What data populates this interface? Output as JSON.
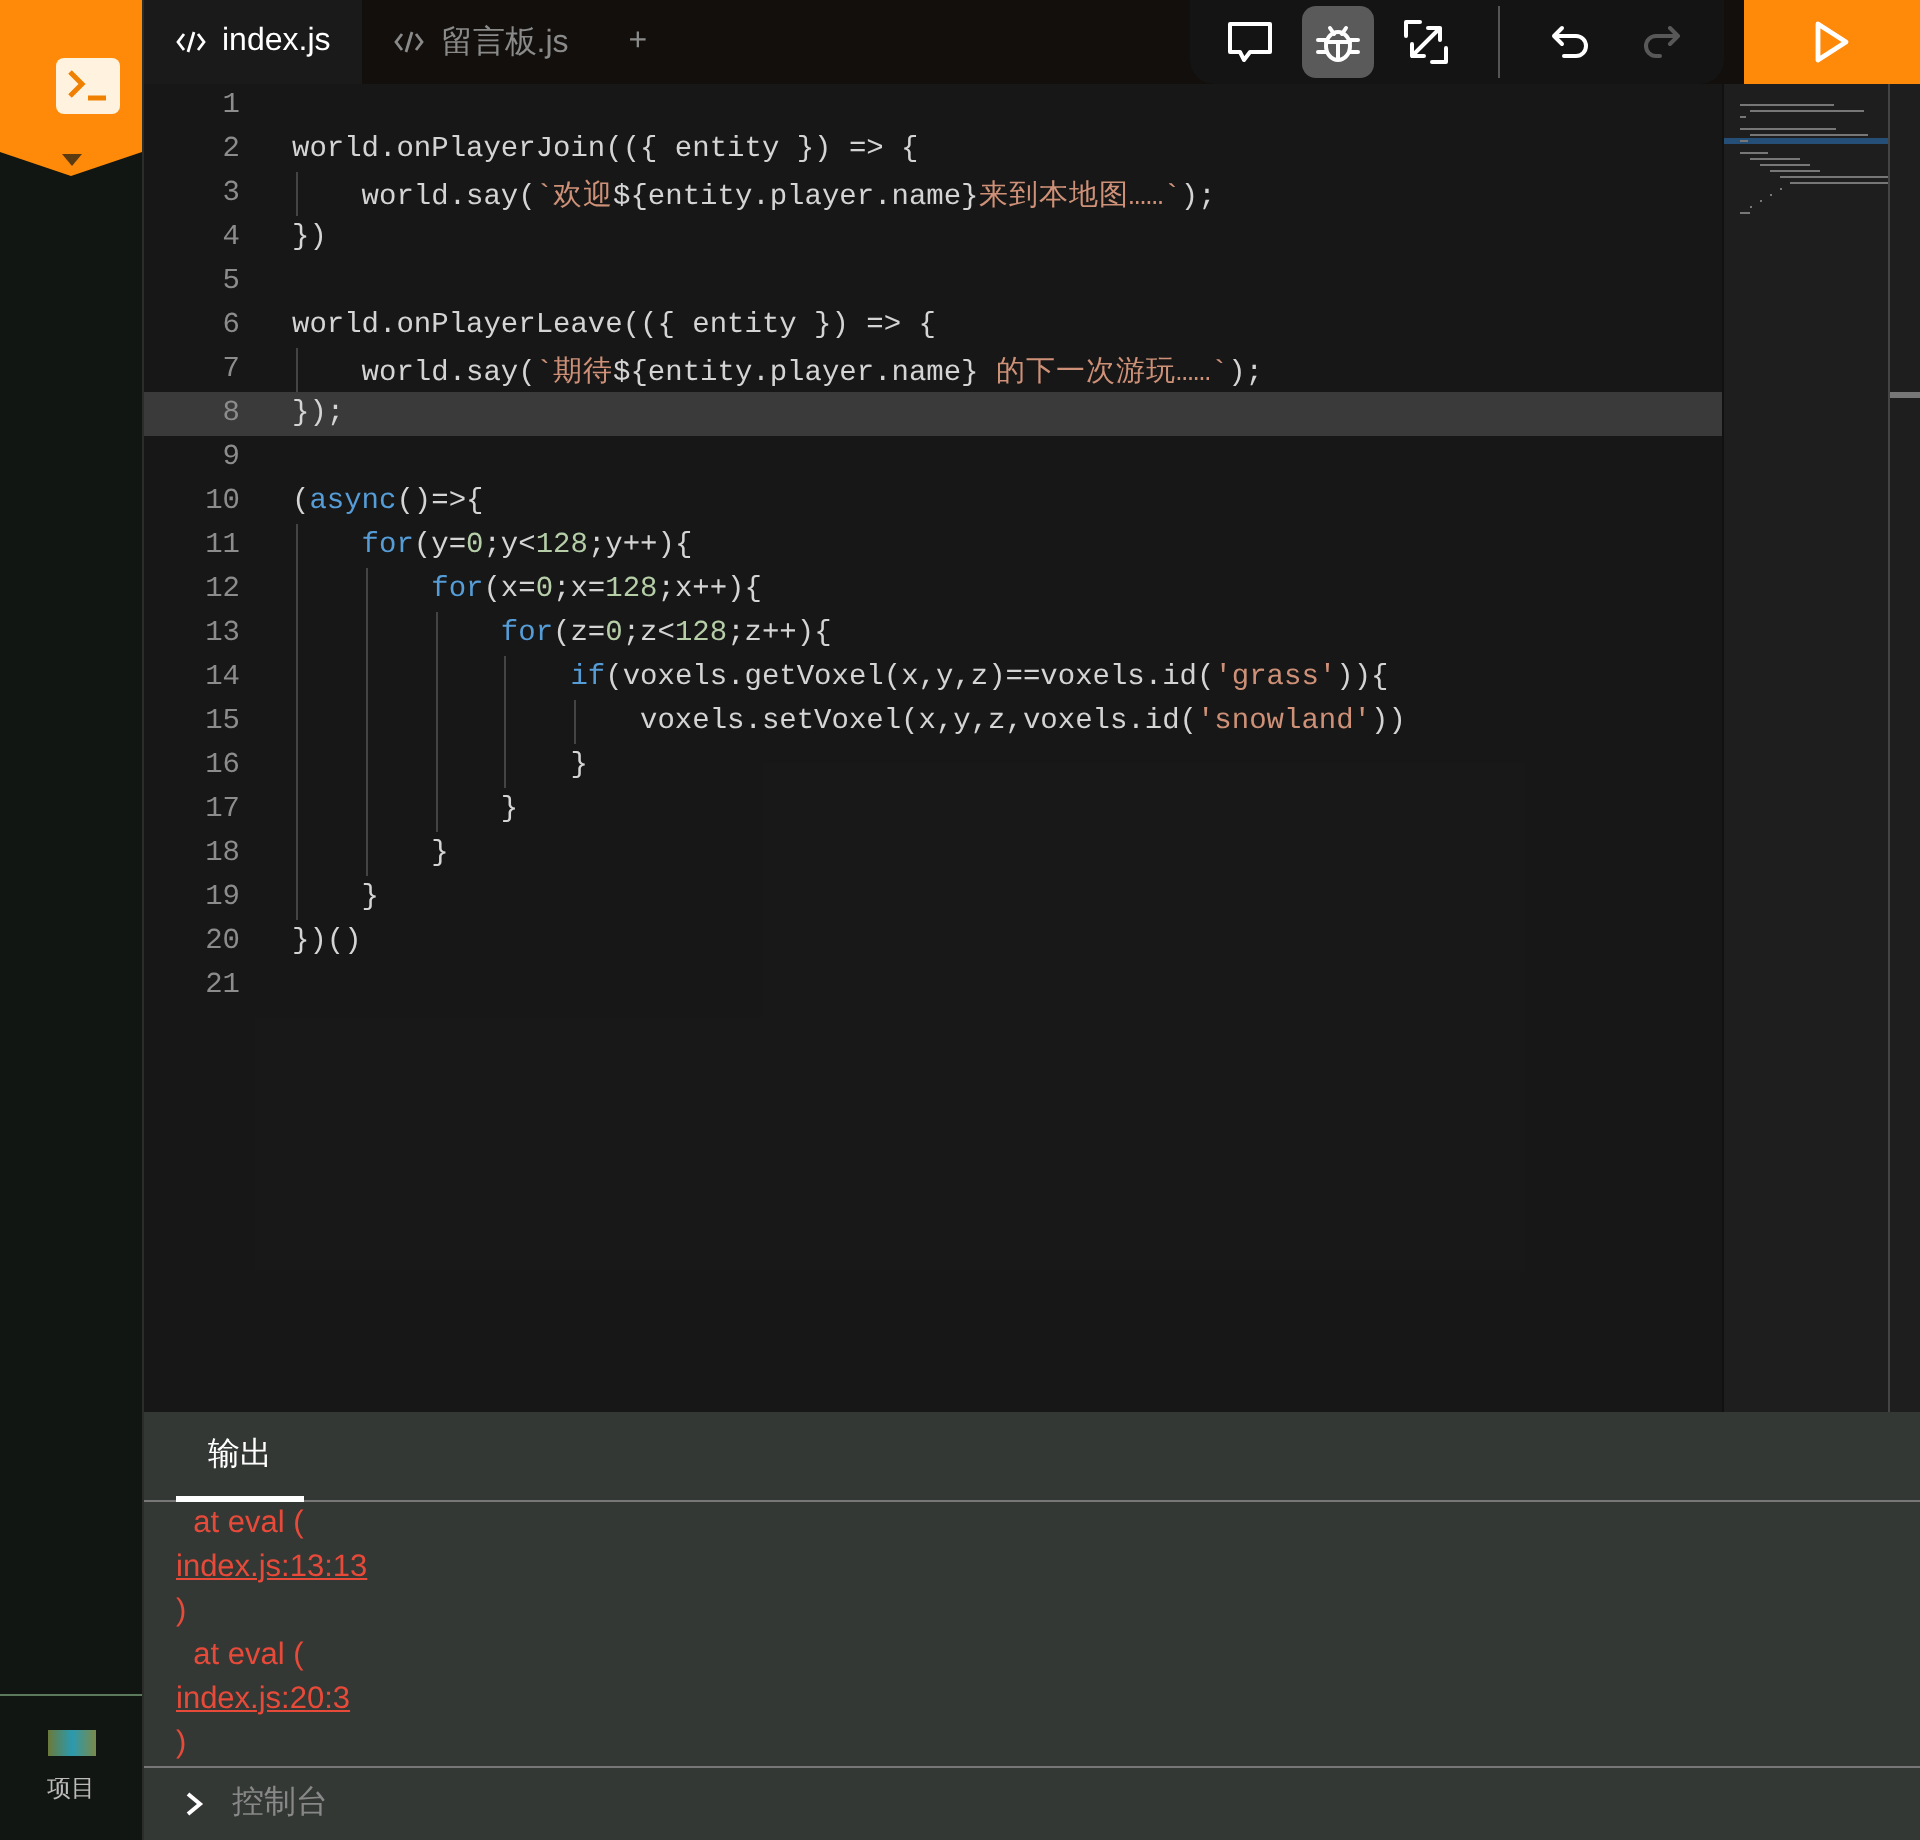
{
  "sidebar": {
    "project": {
      "label": "项目"
    }
  },
  "tabs": [
    {
      "label": "index.js",
      "selected": true,
      "kind": "file"
    },
    {
      "label": "留言板.js",
      "selected": false,
      "kind": "file"
    },
    {
      "label": "+",
      "selected": false,
      "kind": "add"
    }
  ],
  "toolbar": [
    {
      "kind": "comment",
      "selected": false,
      "disabled": false
    },
    {
      "kind": "debug",
      "selected": true,
      "disabled": false
    },
    {
      "kind": "resize",
      "selected": false,
      "disabled": false
    },
    {
      "kind": "undo",
      "selected": false,
      "disabled": false
    },
    {
      "kind": "redo",
      "selected": false,
      "disabled": true
    }
  ],
  "code_lines": [
    {
      "number": "1",
      "selected": false
    },
    {
      "number": "2",
      "selected": false,
      "tokens": [
        {
          "kind": "plain",
          "text": "world.onPlayerJoin(({ entity }) => {"
        }
      ]
    },
    {
      "number": "3",
      "selected": false,
      "tokens": [
        {
          "kind": "plain",
          "text": "    world.say("
        },
        {
          "kind": "string",
          "text": "`欢迎"
        },
        {
          "kind": "plain",
          "text": "${entity.player.name}"
        },
        {
          "kind": "string",
          "text": "来到本地图……`"
        },
        {
          "kind": "plain",
          "text": ");"
        }
      ]
    },
    {
      "number": "4",
      "selected": false,
      "tokens": [
        {
          "kind": "plain",
          "text": "})"
        }
      ]
    },
    {
      "number": "5",
      "selected": false
    },
    {
      "number": "6",
      "selected": false,
      "tokens": [
        {
          "kind": "plain",
          "text": "world.onPlayerLeave(({ entity }) => {"
        }
      ]
    },
    {
      "number": "7",
      "selected": false,
      "tokens": [
        {
          "kind": "plain",
          "text": "    world.say("
        },
        {
          "kind": "string",
          "text": "`期待"
        },
        {
          "kind": "plain",
          "text": "${entity.player.name}"
        },
        {
          "kind": "string",
          "text": " 的下一次游玩……`"
        },
        {
          "kind": "plain",
          "text": ");"
        }
      ]
    },
    {
      "number": "8",
      "selected": true,
      "tokens": [
        {
          "kind": "plain",
          "text": "});"
        }
      ]
    },
    {
      "number": "9",
      "selected": false
    },
    {
      "number": "10",
      "selected": false,
      "tokens": [
        {
          "kind": "plain",
          "text": "("
        },
        {
          "kind": "keyword",
          "text": "async"
        },
        {
          "kind": "plain",
          "text": "()=>{"
        }
      ]
    },
    {
      "number": "11",
      "selected": false,
      "tokens": [
        {
          "kind": "keyword",
          "text": "    for"
        },
        {
          "kind": "plain",
          "text": "(y="
        },
        {
          "kind": "number",
          "text": "0"
        },
        {
          "kind": "plain",
          "text": ";y<"
        },
        {
          "kind": "number",
          "text": "128"
        },
        {
          "kind": "plain",
          "text": ";y++){"
        }
      ]
    },
    {
      "number": "12",
      "selected": false,
      "tokens": [
        {
          "kind": "keyword",
          "text": "        for"
        },
        {
          "kind": "plain",
          "text": "(x="
        },
        {
          "kind": "number",
          "text": "0"
        },
        {
          "kind": "plain",
          "text": ";x="
        },
        {
          "kind": "number",
          "text": "128"
        },
        {
          "kind": "plain",
          "text": ";x++){"
        }
      ]
    },
    {
      "number": "13",
      "selected": false,
      "tokens": [
        {
          "kind": "keyword",
          "text": "            for"
        },
        {
          "kind": "plain",
          "text": "(z="
        },
        {
          "kind": "number",
          "text": "0"
        },
        {
          "kind": "plain",
          "text": ";z<"
        },
        {
          "kind": "number",
          "text": "128"
        },
        {
          "kind": "plain",
          "text": ";z++){"
        }
      ]
    },
    {
      "number": "14",
      "selected": false,
      "tokens": [
        {
          "kind": "keyword",
          "text": "                if"
        },
        {
          "kind": "plain",
          "text": "(voxels.getVoxel(x,y,z)==voxels.id("
        },
        {
          "kind": "string",
          "text": "'grass'"
        },
        {
          "kind": "plain",
          "text": ")){"
        }
      ]
    },
    {
      "number": "15",
      "selected": false,
      "tokens": [
        {
          "kind": "plain",
          "text": "                    voxels.setVoxel(x,y,z,voxels.id("
        },
        {
          "kind": "string",
          "text": "'snowland'"
        },
        {
          "kind": "plain",
          "text": "))"
        }
      ]
    },
    {
      "number": "16",
      "selected": false,
      "tokens": [
        {
          "kind": "plain",
          "text": "                }"
        }
      ]
    },
    {
      "number": "17",
      "selected": false,
      "tokens": [
        {
          "kind": "plain",
          "text": "            }"
        }
      ]
    },
    {
      "number": "18",
      "selected": false,
      "tokens": [
        {
          "kind": "plain",
          "text": "        }"
        }
      ]
    },
    {
      "number": "19",
      "selected": false,
      "tokens": [
        {
          "kind": "plain",
          "text": "    }"
        }
      ]
    },
    {
      "number": "20",
      "selected": false,
      "tokens": [
        {
          "kind": "plain",
          "text": "})()"
        }
      ]
    },
    {
      "number": "21",
      "selected": false
    }
  ],
  "output": {
    "tabs": [
      {
        "label": "输出",
        "selected": true
      }
    ],
    "lines": [
      {
        "kind": "text",
        "text": "  at eval ("
      },
      {
        "kind": "link",
        "text": "index.js:13:13"
      },
      {
        "kind": "text",
        "text": ")"
      },
      {
        "kind": "text",
        "text": "  at eval ("
      },
      {
        "kind": "link",
        "text": "index.js:20:3"
      },
      {
        "kind": "text",
        "text": ")"
      }
    ],
    "console": {
      "placeholder": "控制台"
    }
  }
}
